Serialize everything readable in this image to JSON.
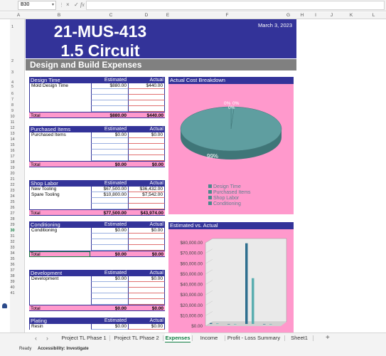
{
  "formula_bar": {
    "name_box": "B30",
    "fx_label": "fx",
    "cancel_icon": "×",
    "confirm_icon": "✓"
  },
  "columns": [
    "A",
    "B",
    "C",
    "D",
    "E",
    "F",
    "G",
    "H",
    "I",
    "J",
    "K",
    "L"
  ],
  "rows": [
    "1",
    "2",
    "3",
    "4",
    "5",
    "6",
    "7",
    "8",
    "9",
    "10",
    "11",
    "12",
    "13",
    "14",
    "15",
    "16",
    "17",
    "18",
    "19",
    "20",
    "21",
    "22",
    "23",
    "24",
    "25",
    "26",
    "27",
    "28",
    "29",
    "30",
    "31",
    "32",
    "33",
    "34",
    "35",
    "36",
    "37",
    "38",
    "39",
    "40",
    "41"
  ],
  "header": {
    "title_line1": "21-MUS-413",
    "title_line2": "1.5 Circuit",
    "date": "March 3, 2023",
    "subtitle": "Design and Build Expenses"
  },
  "col_labels": {
    "estimated": "Estimated",
    "actual": "Actual",
    "total": "Total"
  },
  "sections": [
    {
      "title": "Design Time",
      "rows": [
        {
          "label": "Mold Design Time",
          "estimated": "$880.00",
          "actual": "$440.00"
        },
        {
          "label": "",
          "estimated": "",
          "actual": ""
        },
        {
          "label": "",
          "estimated": "",
          "actual": ""
        },
        {
          "label": "",
          "estimated": "",
          "actual": ""
        },
        {
          "label": "",
          "estimated": "",
          "actual": ""
        }
      ],
      "total_estimated": "$880.00",
      "total_actual": "$440.00"
    },
    {
      "title": "Purchased Items",
      "rows": [
        {
          "label": "Purchased Items",
          "estimated": "$0.00",
          "actual": "$0.00"
        },
        {
          "label": "",
          "estimated": "",
          "actual": ""
        },
        {
          "label": "",
          "estimated": "",
          "actual": ""
        },
        {
          "label": "",
          "estimated": "",
          "actual": ""
        },
        {
          "label": "",
          "estimated": "",
          "actual": ""
        }
      ],
      "total_estimated": "$0.00",
      "total_actual": "$0.00"
    },
    {
      "title": "Shop Labor",
      "rows": [
        {
          "label": "New Tooling",
          "estimated": "$67,500.00",
          "actual": "$36,432.00"
        },
        {
          "label": "Spare Tooling",
          "estimated": "$10,800.00",
          "actual": "$7,542.00"
        },
        {
          "label": "",
          "estimated": "",
          "actual": ""
        },
        {
          "label": "",
          "estimated": "",
          "actual": ""
        }
      ],
      "total_estimated": "$77,500.00",
      "total_actual": "$43,974.00"
    },
    {
      "title": "Conditioning",
      "rows": [
        {
          "label": "Conditioning",
          "estimated": "$0.00",
          "actual": "$0.00"
        },
        {
          "label": "",
          "estimated": "",
          "actual": ""
        },
        {
          "label": "",
          "estimated": "",
          "actual": ""
        },
        {
          "label": "",
          "estimated": "",
          "actual": ""
        }
      ],
      "total_estimated": "$0.00",
      "total_actual": "$0.00"
    },
    {
      "title": "Development",
      "rows": [
        {
          "label": "Development",
          "estimated": "$0.00",
          "actual": "$0.00"
        },
        {
          "label": "",
          "estimated": "",
          "actual": ""
        },
        {
          "label": "",
          "estimated": "",
          "actual": ""
        },
        {
          "label": "",
          "estimated": "",
          "actual": ""
        },
        {
          "label": "",
          "estimated": "",
          "actual": ""
        }
      ],
      "total_estimated": "$0.00",
      "total_actual": "$0.00"
    },
    {
      "title": "Plating",
      "rows": [
        {
          "label": "Resin",
          "estimated": "$0.00",
          "actual": "$0.00"
        }
      ],
      "total_estimated": "",
      "total_actual": ""
    }
  ],
  "pie_chart": {
    "title": "Actual Cost Breakdown",
    "slice_labels": [
      "0%",
      "0%",
      "0%",
      "99%"
    ],
    "legend": [
      "Design Time",
      "Purchased Items",
      "Shop Labor",
      "Conditioning"
    ],
    "colors": {
      "pie": "#5f9ea0",
      "pie_dark": "#3f7678",
      "legend_swatch": "#4a8a8c"
    }
  },
  "bar_chart": {
    "title": "Estimated vs. Actual",
    "y_ticks": [
      "$80,000.00",
      "$70,000.00",
      "$60,000.00",
      "$50,000.00",
      "$40,000.00",
      "$30,000.00",
      "$20,000.00",
      "$10,000.00",
      "$0.00"
    ]
  },
  "chart_data": [
    {
      "type": "pie",
      "title": "Actual Cost Breakdown",
      "categories": [
        "Design Time",
        "Purchased Items",
        "Shop Labor",
        "Conditioning"
      ],
      "values": [
        440,
        0,
        43974,
        0
      ],
      "labels": [
        "0%",
        "0%",
        "99%",
        "0%"
      ]
    },
    {
      "type": "bar",
      "title": "Estimated vs. Actual",
      "categories": [
        "Design Time",
        "Purchased Items",
        "Shop Labor",
        "Conditioning"
      ],
      "series": [
        {
          "values": [
            880,
            0,
            77500,
            0
          ]
        },
        {
          "values": [
            440,
            0,
            43974,
            0
          ]
        }
      ],
      "ylim": [
        0,
        80000
      ]
    }
  ],
  "tabs": [
    "Project TL Phase 1",
    "Project TL Phase 2",
    "Expenses",
    "Income",
    "Profit - Loss Summary",
    "Sheet1"
  ],
  "active_tab": "Expenses",
  "status": {
    "ready": "Ready",
    "accessibility": "Accessibility: Investigate"
  },
  "colors": {
    "navy": "#333399",
    "pink": "#ff99cc",
    "gray": "#808080",
    "excel_green": "#107c41"
  }
}
